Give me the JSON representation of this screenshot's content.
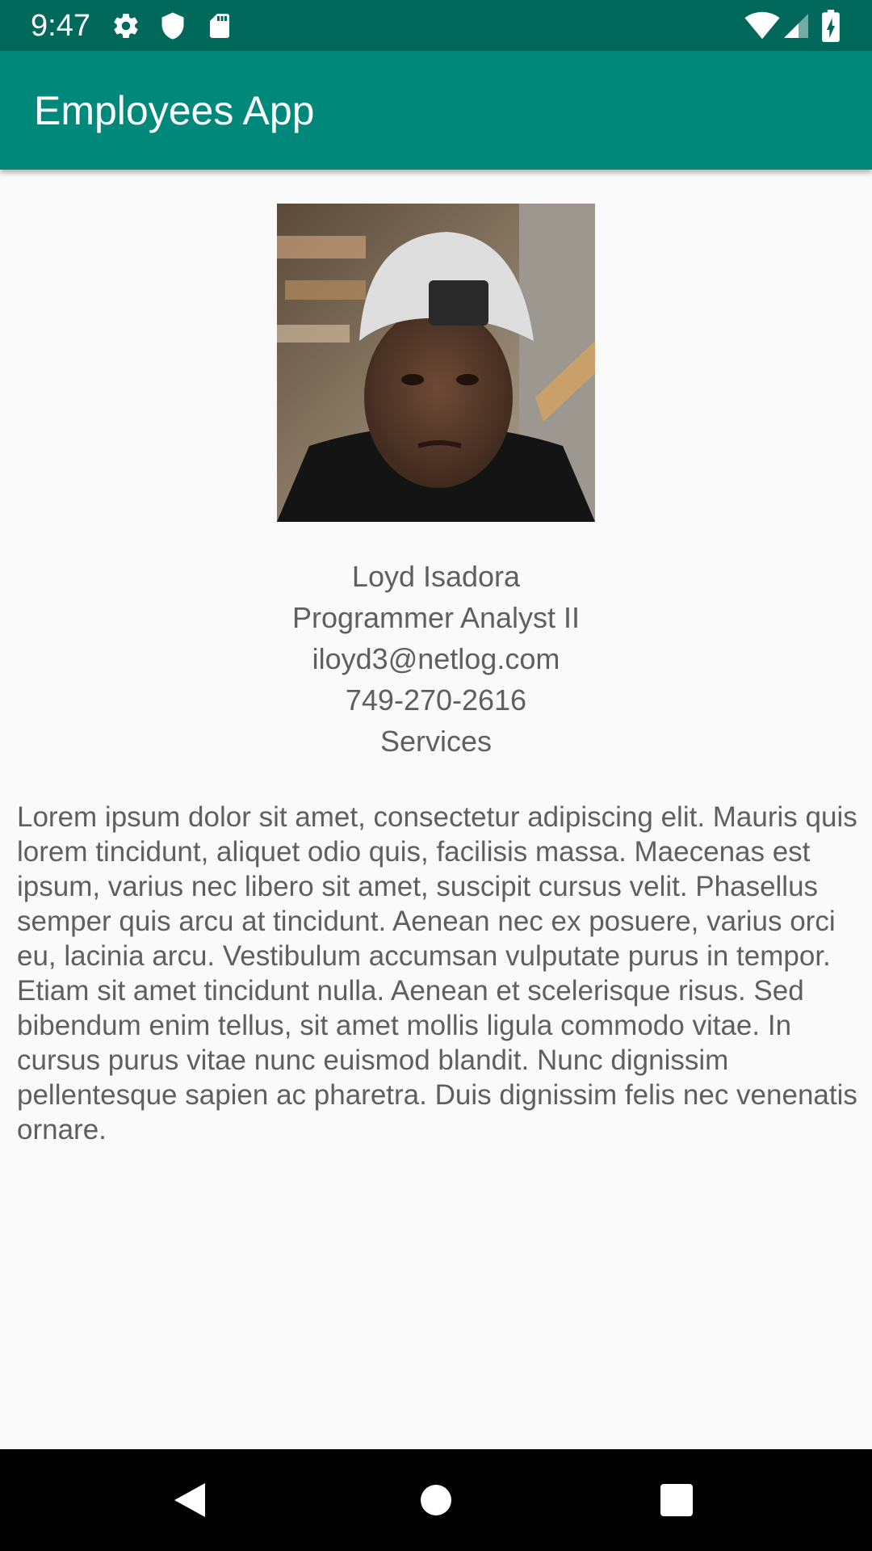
{
  "status_bar": {
    "time": "9:47",
    "icons": [
      "gear-icon",
      "shield-icon",
      "sd-card-icon",
      "wifi-icon",
      "cell-signal-icon",
      "battery-charging-icon"
    ],
    "color": "#00695c"
  },
  "app_bar": {
    "title": "Employees App",
    "color": "#00897b"
  },
  "employee": {
    "photo": "employee-photo",
    "name": "Loyd Isadora",
    "title": "Programmer Analyst II",
    "email": "iloyd3@netlog.com",
    "phone": "749-270-2616",
    "department": "Services",
    "bio": "Lorem ipsum dolor sit amet, consectetur adipiscing elit. Mauris quis lorem tincidunt, aliquet odio quis, facilisis massa. Maecenas est ipsum, varius nec libero sit amet, suscipit cursus velit. Phasellus semper quis arcu at tincidunt. Aenean nec ex posuere, varius orci eu, lacinia arcu. Vestibulum accumsan vulputate purus in tempor. Etiam sit amet tincidunt nulla. Aenean et scelerisque risus. Sed bibendum enim tellus, sit amet mollis ligula commodo vitae. In cursus purus vitae nunc euismod blandit. Nunc dignissim pellentesque sapien ac pharetra. Duis dignissim felis nec venenatis ornare."
  },
  "nav_bar": {
    "buttons": [
      "back-icon",
      "home-icon",
      "recents-icon"
    ]
  }
}
